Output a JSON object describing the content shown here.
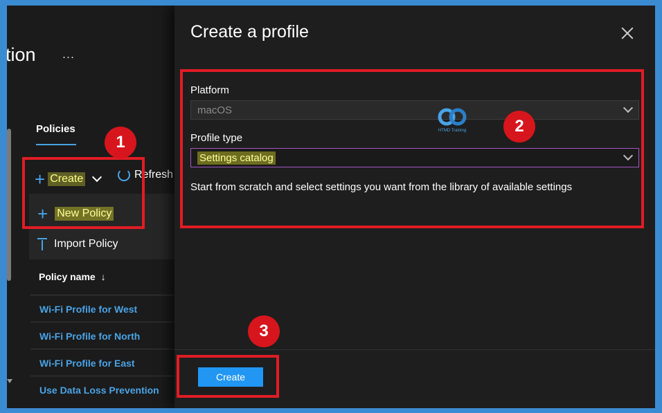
{
  "background_page": {
    "title_fragment": "tion",
    "ellipsis": "...",
    "tabs": [
      {
        "label": "Policies",
        "active": true
      }
    ],
    "toolbar": {
      "create_label": "Create",
      "refresh_label": "Refresh"
    },
    "create_menu": [
      {
        "label": "New Policy",
        "icon": "plus-icon"
      },
      {
        "label": "Import Policy",
        "icon": "upload-icon"
      }
    ],
    "table": {
      "column_header": "Policy name",
      "sort_indicator": "↓",
      "rows": [
        "Wi-Fi Profile for West",
        "Wi-Fi Profile for North",
        "Wi-Fi Profile for East",
        "Use Data Loss Prevention"
      ]
    }
  },
  "panel": {
    "title": "Create a profile",
    "platform": {
      "label": "Platform",
      "value": "macOS",
      "disabled": true
    },
    "profile_type": {
      "label": "Profile type",
      "value": "Settings catalog"
    },
    "description": "Start from scratch and select settings you want from the library of available settings",
    "create_button_label": "Create"
  },
  "watermark_text": "HTMD Training",
  "annotations": {
    "badges": [
      "1",
      "2",
      "3"
    ],
    "color": "#e01c24"
  },
  "colors": {
    "accent": "#4aa3e6",
    "primary_button": "#2196f3",
    "highlight": "#e6e63c"
  }
}
